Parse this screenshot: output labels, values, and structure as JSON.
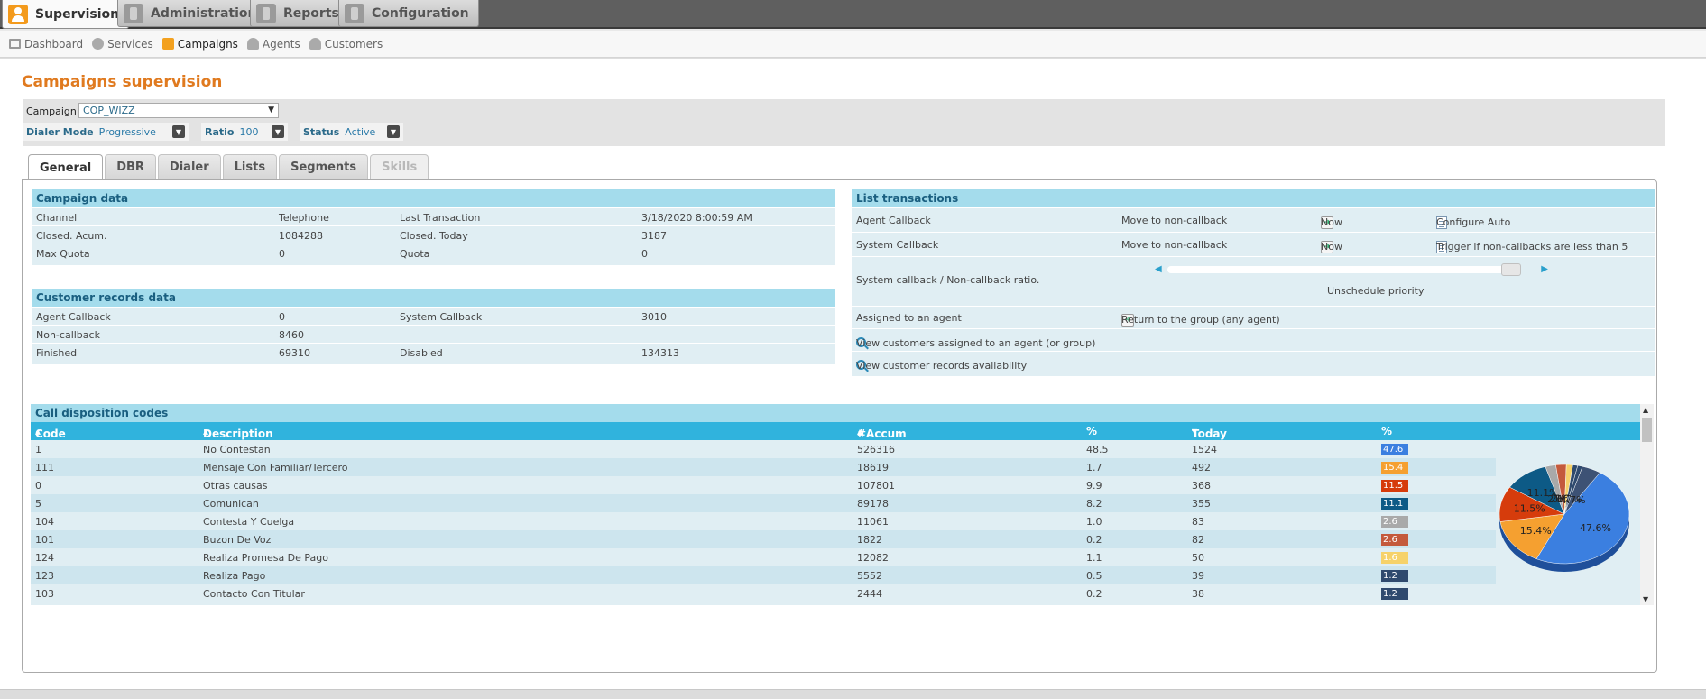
{
  "topnav": {
    "tabs": [
      {
        "label": "Supervision"
      },
      {
        "label": "Administration"
      },
      {
        "label": "Reports"
      },
      {
        "label": "Configuration"
      }
    ]
  },
  "subnav": {
    "items": [
      {
        "label": "Dashboard"
      },
      {
        "label": "Services"
      },
      {
        "label": "Campaigns"
      },
      {
        "label": "Agents"
      },
      {
        "label": "Customers"
      }
    ]
  },
  "page": {
    "title": "Campaigns supervision"
  },
  "filters": {
    "campaign_label": "Campaign",
    "campaign_value": "COP_WIZZ",
    "dialer_mode_label": "Dialer Mode",
    "dialer_mode_value": "Progressive",
    "ratio_label": "Ratio",
    "ratio_value": "100",
    "status_label": "Status",
    "status_value": "Active"
  },
  "tabs": [
    "General",
    "DBR",
    "Dialer",
    "Lists",
    "Segments",
    "Skills"
  ],
  "campaign_data": {
    "title": "Campaign data",
    "rows": [
      [
        "Channel",
        "Telephone",
        "Last Transaction",
        "3/18/2020 8:00:59 AM"
      ],
      [
        "Closed. Acum.",
        "1084288",
        "Closed. Today",
        "3187"
      ],
      [
        "Max Quota",
        "0",
        "Quota",
        "0"
      ]
    ]
  },
  "customer_records": {
    "title": "Customer records data",
    "rows": [
      [
        "Agent Callback",
        "0",
        "System Callback",
        "3010"
      ],
      [
        "Non-callback",
        "8460",
        "",
        ""
      ],
      [
        "Finished",
        "69310",
        "Disabled",
        "134313"
      ]
    ]
  },
  "list_transactions": {
    "title": "List transactions",
    "agent_callback": {
      "label": "Agent Callback",
      "action": "Move to non-callback",
      "when": "Now",
      "config": "Configure Auto"
    },
    "system_callback": {
      "label": "System Callback",
      "action": "Move to non-callback",
      "when": "Now",
      "config": "Trigger if non-callbacks are less than 5"
    },
    "ratio": {
      "label": "System callback / Non-callback ratio.",
      "caption": "Unschedule priority"
    },
    "assigned": {
      "label": "Assigned to an agent",
      "action": "Return to the group (any agent)"
    },
    "view_assigned": "View customers assigned to an agent (or group)",
    "view_availability": "View customer records availability"
  },
  "disposition": {
    "title": "Call disposition codes",
    "headers": {
      "code": "Code",
      "description": "Description",
      "accum": "#Accum",
      "pct1": "%",
      "today": "Today",
      "pct2": "%"
    },
    "rows": [
      {
        "code": "1",
        "description": "No Contestan",
        "accum": "526316",
        "pct": "48.5",
        "today": "1524",
        "pct_today": "47.6",
        "color": "#3b7fe0"
      },
      {
        "code": "111",
        "description": "Mensaje Con Familiar/Tercero",
        "accum": "18619",
        "pct": "1.7",
        "today": "492",
        "pct_today": "15.4",
        "color": "#f5a030"
      },
      {
        "code": "0",
        "description": "Otras causas",
        "accum": "107801",
        "pct": "9.9",
        "today": "368",
        "pct_today": "11.5",
        "color": "#d63c0c"
      },
      {
        "code": "5",
        "description": "Comunican",
        "accum": "89178",
        "pct": "8.2",
        "today": "355",
        "pct_today": "11.1",
        "color": "#0d5a86"
      },
      {
        "code": "104",
        "description": "Contesta Y Cuelga",
        "accum": "11061",
        "pct": "1.0",
        "today": "83",
        "pct_today": "2.6",
        "color": "#a9a9a9"
      },
      {
        "code": "101",
        "description": "Buzon De Voz",
        "accum": "1822",
        "pct": "0.2",
        "today": "82",
        "pct_today": "2.6",
        "color": "#c45a3c"
      },
      {
        "code": "124",
        "description": "Realiza Promesa De Pago",
        "accum": "12082",
        "pct": "1.1",
        "today": "50",
        "pct_today": "1.6",
        "color": "#f6d26a"
      },
      {
        "code": "123",
        "description": "Realiza Pago",
        "accum": "5552",
        "pct": "0.5",
        "today": "39",
        "pct_today": "1.2",
        "color": "#2f4a6e"
      },
      {
        "code": "103",
        "description": "Contacto Con Titular",
        "accum": "2444",
        "pct": "0.2",
        "today": "38",
        "pct_today": "1.2",
        "color": "#2f4a6e"
      }
    ]
  },
  "chart_data": {
    "type": "pie",
    "slices": [
      {
        "label": "47.6%",
        "value": 47.6,
        "color": "#3b7fe0"
      },
      {
        "label": "15.4%",
        "value": 15.4,
        "color": "#f5a030"
      },
      {
        "label": "11.5%",
        "value": 11.5,
        "color": "#d63c0c"
      },
      {
        "label": "11.1%",
        "value": 11.1,
        "color": "#0d5a86"
      },
      {
        "label": "2.6%",
        "value": 2.6,
        "color": "#a9a9a9"
      },
      {
        "label": "2.6%",
        "value": 2.6,
        "color": "#c45a3c"
      },
      {
        "label": "1.6%",
        "value": 1.6,
        "color": "#f6d26a"
      },
      {
        "label": "1.2%",
        "value": 1.2,
        "color": "#2f4a6e"
      },
      {
        "label": "1.2%",
        "value": 1.2,
        "color": "#2f4a6e"
      },
      {
        "label": "4.7%",
        "value": 4.7,
        "color": "#3d5275"
      }
    ]
  }
}
